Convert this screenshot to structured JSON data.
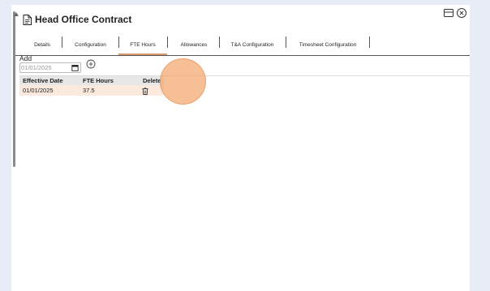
{
  "window": {
    "title": "Head Office Contract",
    "title_icon": "document-icon",
    "controls": [
      "restore-window-icon",
      "close-icon"
    ]
  },
  "tabs": [
    {
      "label": "Details",
      "active": false
    },
    {
      "label": "Configuration",
      "active": false
    },
    {
      "label": "FTE Hours",
      "active": true
    },
    {
      "label": "Allowances",
      "active": false
    },
    {
      "label": "T&A Configuration",
      "active": false
    },
    {
      "label": "Timesheet Configuration",
      "active": false
    }
  ],
  "add_section": {
    "label": "Add",
    "date_placeholder": "01/01/2025",
    "calendar_icon": "calendar-icon",
    "add_icon": "plus-circle-icon"
  },
  "table": {
    "headers": [
      "Effective Date",
      "FTE Hours",
      "Delete"
    ],
    "rows": [
      {
        "effective_date": "01/01/2025",
        "fte_hours": "37.5",
        "delete_icon": "trash-icon"
      }
    ]
  },
  "colors": {
    "accent": "#d9986a",
    "row_highlight": "#fbe9dd",
    "background": "#e8ecf6",
    "click_indicator": "#f2a66c"
  }
}
